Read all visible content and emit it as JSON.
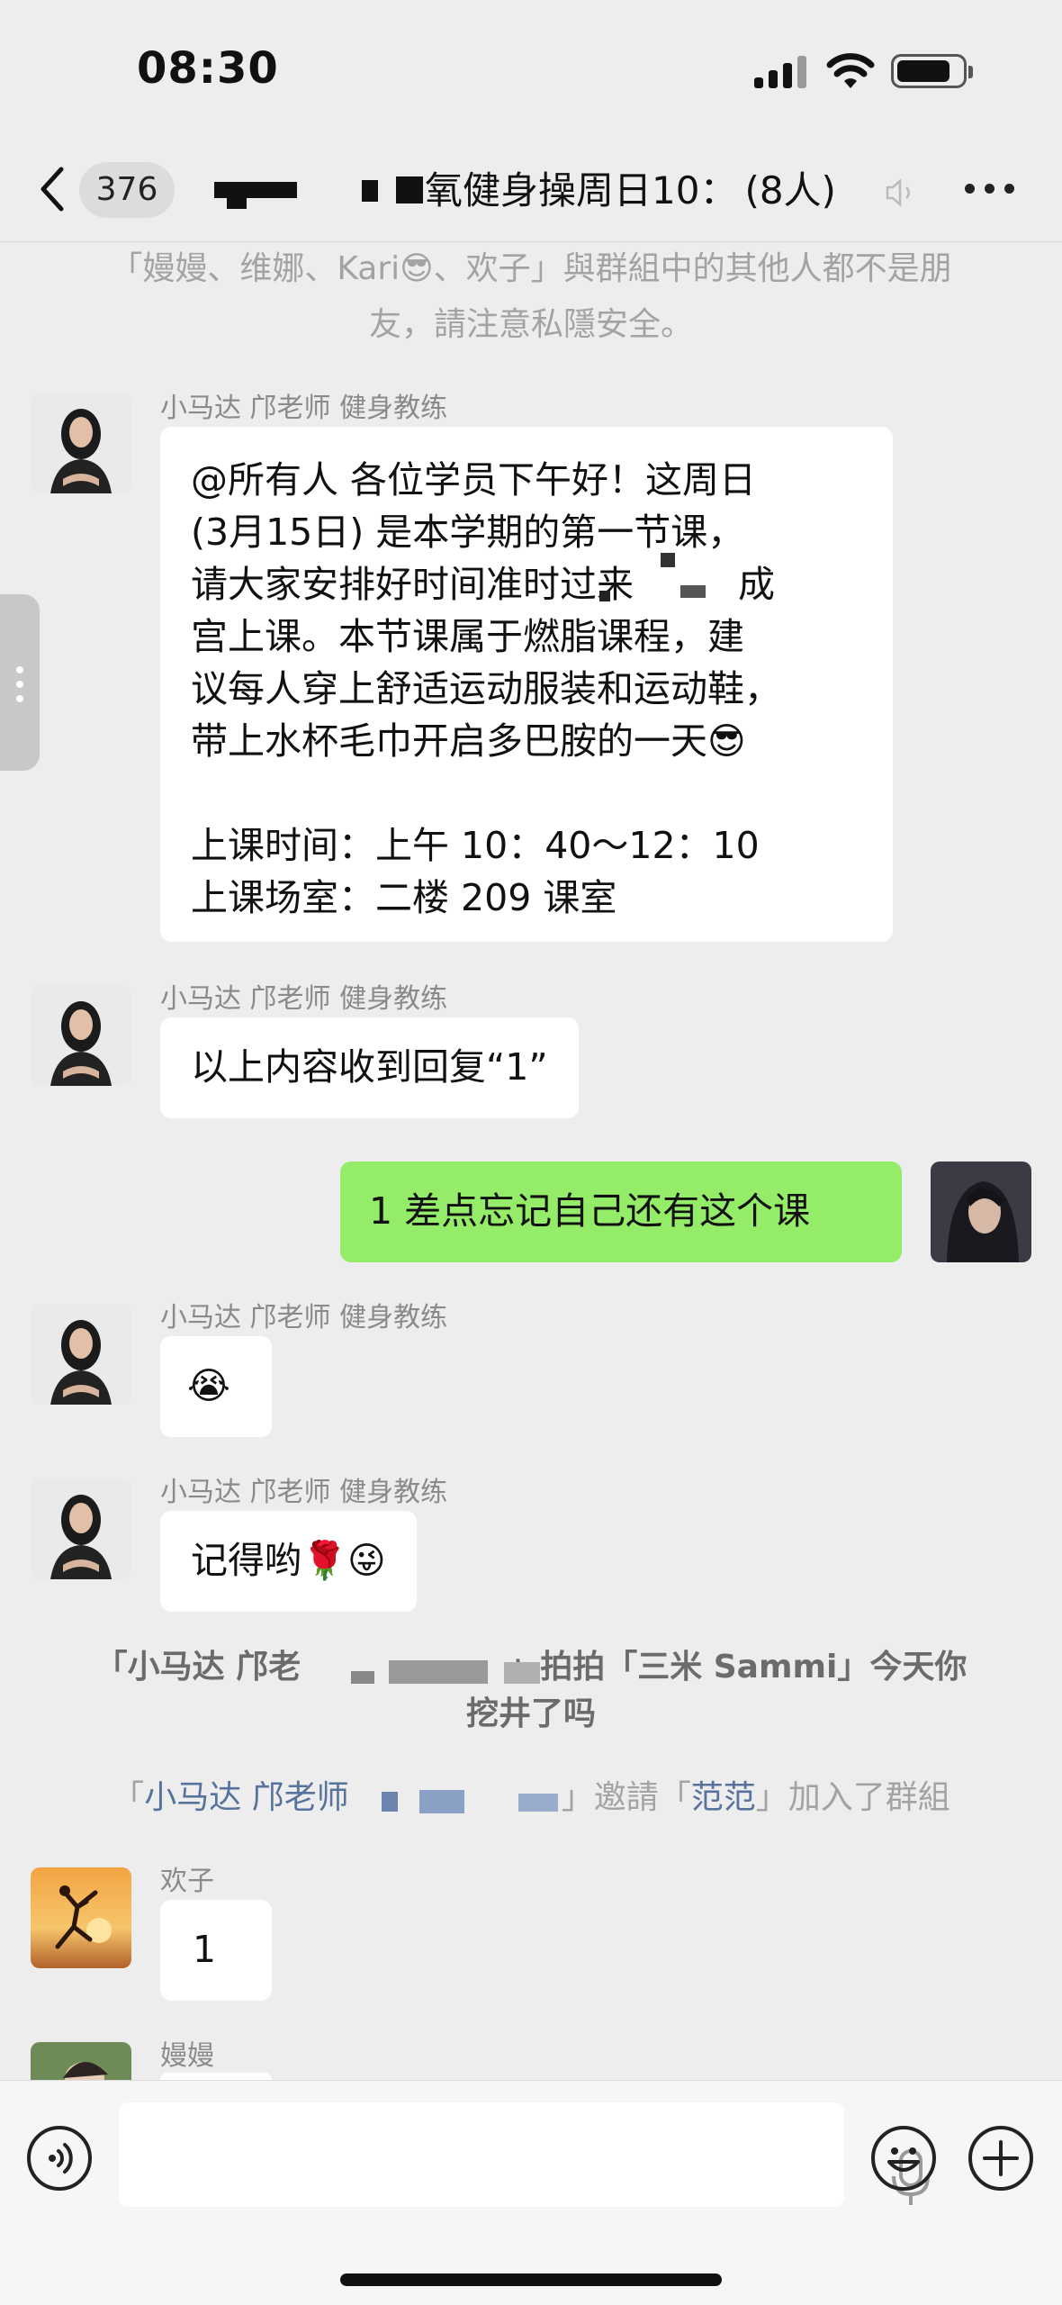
{
  "status_bar": {
    "time": "08:30"
  },
  "navbar": {
    "unread_count": "376",
    "title": "氧健身操周日10：",
    "member_count": "(8人)"
  },
  "privacy_notice": {
    "line1": "「嫚嫚、维娜、Kari😎、欢子」與群組中的其他人都不是朋",
    "line2": "友，請注意私隱安全。"
  },
  "messages": [
    {
      "sender": "小马达 邝老师 健身教练",
      "lines": [
        "@所有人 各位学员下午好！这周日",
        "(3月15日) 是本学期的第一节课，",
        "请大家安排好时间准时过来",
        "宫上课。本节课属于燃脂课程，建",
        "议每人穿上舒适运动服装和运动鞋，",
        "带上水杯毛巾开启多巴胺的一天😎",
        "",
        "上课时间：上午 10：40～12：10",
        "上课场室：二楼 209 课室"
      ],
      "line3_tail": "成"
    },
    {
      "sender": "小马达 邝老师 健身教练",
      "text": "以上内容收到回复“1”"
    },
    {
      "sender": "me",
      "text": "1 差点忘记自己还有这个课"
    },
    {
      "sender": "小马达 邝老师 健身教练",
      "text": "😭"
    },
    {
      "sender": "小马达 邝老师 健身教练",
      "text": "记得哟🌹😜"
    }
  ],
  "pat_notice": {
    "prefix": "「小马达 邝老",
    "middle": "」拍拍「三米 Sammi」今天你",
    "line2": "挖井了吗"
  },
  "invite_notice": {
    "open": "「",
    "inviter": "小马达 邝老师",
    "mid": "」邀請「",
    "invitee": "范范",
    "close": "」加入了群組"
  },
  "later_messages": [
    {
      "sender": "欢子",
      "text": "1"
    },
    {
      "sender": "嫚嫚",
      "text": ""
    }
  ],
  "icons": [
    "back-icon",
    "mute-icon",
    "more-icon",
    "voice-icon",
    "mic-icon",
    "emoji-icon",
    "plus-icon"
  ]
}
